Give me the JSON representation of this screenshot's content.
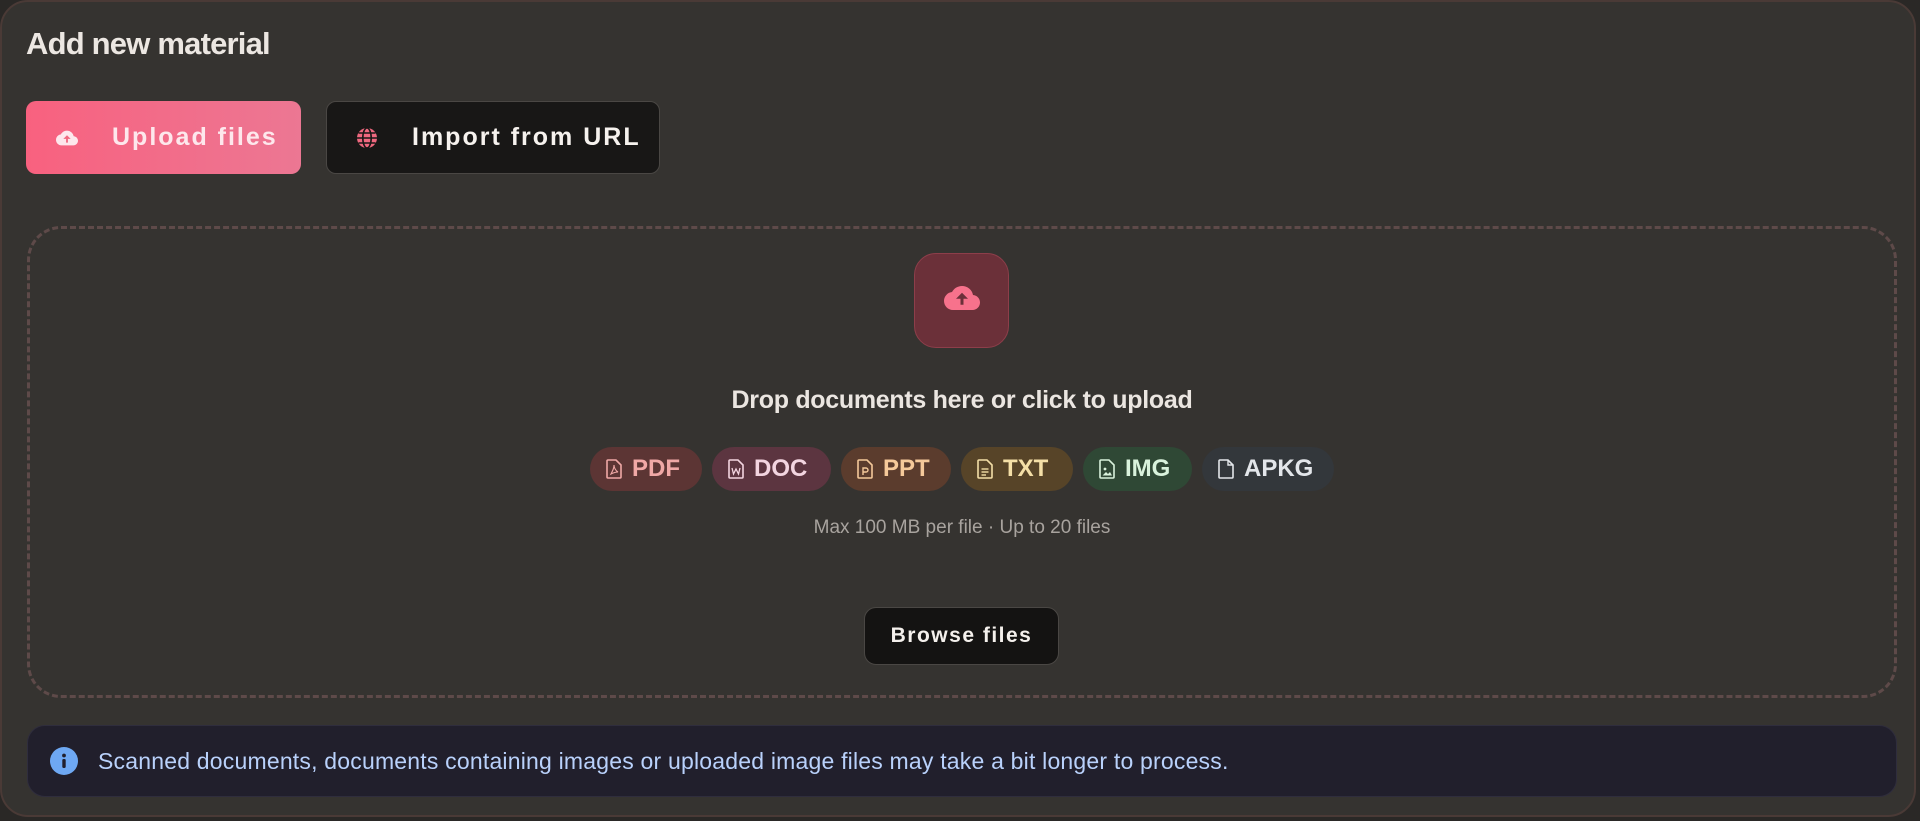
{
  "header": {
    "title": "Add new material"
  },
  "tabs": [
    {
      "label": "Upload files",
      "icon": "cloud-upload-icon",
      "active": true
    },
    {
      "label": "Import from URL",
      "icon": "globe-icon",
      "active": false
    }
  ],
  "dropzone": {
    "icon": "cloud-upload-icon",
    "prompt": "Drop documents here or click to upload",
    "formats": [
      {
        "label": "PDF",
        "icon": "pdf-file-icon",
        "color": "#f0a8a6"
      },
      {
        "label": "DOC",
        "icon": "word-file-icon",
        "color": "#f3d5e0"
      },
      {
        "label": "PPT",
        "icon": "powerpoint-file-icon",
        "color": "#f5c99a"
      },
      {
        "label": "TXT",
        "icon": "text-file-icon",
        "color": "#f4dfa7"
      },
      {
        "label": "IMG",
        "icon": "image-file-icon",
        "color": "#d9f2dc"
      },
      {
        "label": "APKG",
        "icon": "file-icon",
        "color": "#e3e6ea"
      }
    ],
    "limits": "Max 100 MB per file · Up to 20 files",
    "browse_label": "Browse files"
  },
  "notice": {
    "icon": "info-icon",
    "text": "Scanned documents, documents containing images or uploaded image files may take a bit longer to process."
  },
  "colors": {
    "accent": "#f8617f",
    "background": "#353330",
    "info": "#6ea8f3"
  }
}
